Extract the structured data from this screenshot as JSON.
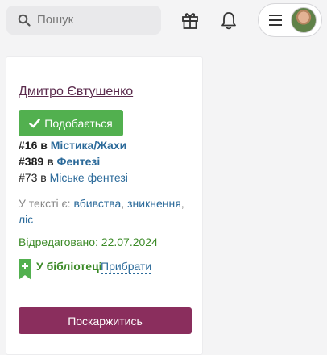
{
  "header": {
    "search": {
      "placeholder": "Пошук",
      "icon": "search-icon"
    },
    "gift_icon": "gift-icon",
    "bell_icon": "bell-icon",
    "menu_icon": "hamburger-icon"
  },
  "book": {
    "author": "Дмитро Євтушенко",
    "like_label": "Подобається",
    "ranks": [
      {
        "prefix": "#16 в ",
        "category": "Містика/Жахи"
      },
      {
        "prefix": "#389 в ",
        "category": "Фентезі"
      },
      {
        "prefix": "#73 в ",
        "category": "Міське фентезі"
      }
    ],
    "tags_prefix": "У тексті є: ",
    "tags": [
      "вбивства",
      "зникнення",
      "ліс"
    ],
    "tags_sep": ", ",
    "edited": "Відредаговано: 22.07.2024",
    "library_status": "У бібліотеці",
    "remove_label": "Прибрати",
    "complain_label": "Поскаржитись"
  },
  "colors": {
    "accent_purple": "#8a2e5d",
    "like_green": "#52b04f",
    "link_blue": "#2b6a9a",
    "status_green": "#3b8a27"
  }
}
